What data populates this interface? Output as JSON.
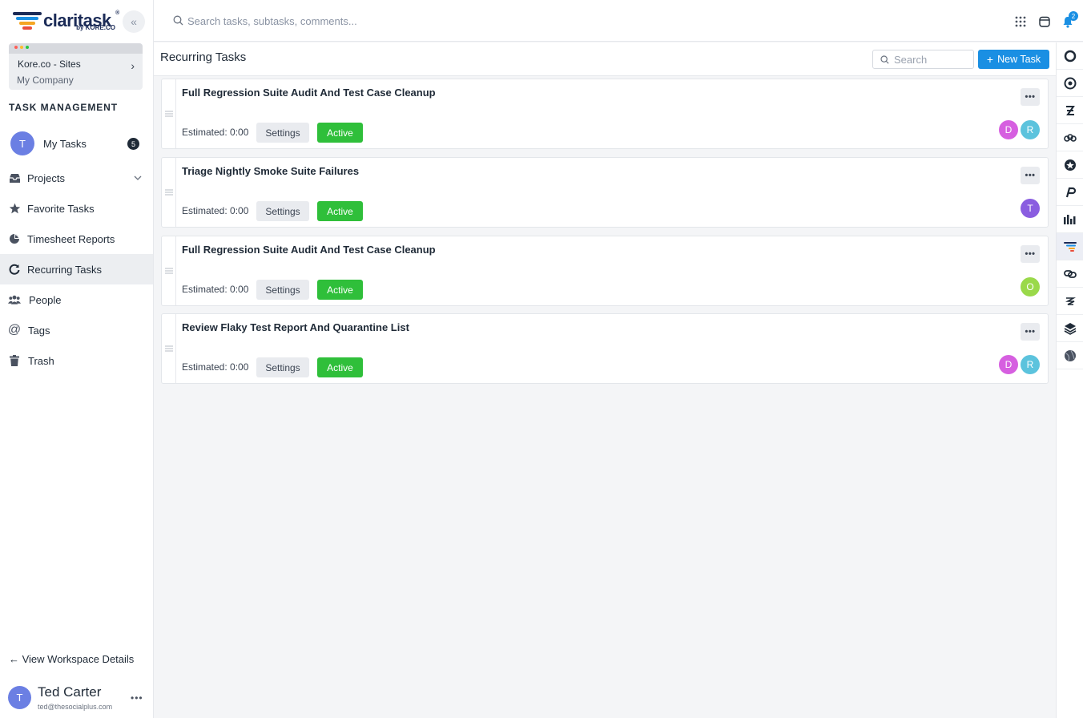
{
  "app": {
    "logo_text": "claritask",
    "logo_sub": "by KORE.CO",
    "logo_reg": "®"
  },
  "workspace": {
    "name": "Kore.co - Sites",
    "company": "My Company"
  },
  "sidebar": {
    "section_title": "TASK MANAGEMENT",
    "my_tasks": {
      "avatar": "T",
      "label": "My Tasks",
      "count": "5"
    },
    "items": [
      {
        "label": "Projects",
        "icon": "inbox-icon"
      },
      {
        "label": "Favorite Tasks",
        "icon": "star-icon"
      },
      {
        "label": "Timesheet Reports",
        "icon": "pie-chart-icon"
      },
      {
        "label": "Recurring Tasks",
        "icon": "refresh-icon"
      },
      {
        "label": "People",
        "icon": "people-icon"
      },
      {
        "label": "Tags",
        "icon": "at-icon"
      },
      {
        "label": "Trash",
        "icon": "trash-icon"
      }
    ],
    "view_workspace": "← View Workspace Details",
    "user": {
      "avatar": "T",
      "name": "Ted Carter",
      "email": "ted@thesocialplus.com",
      "more": "•••"
    }
  },
  "topbar": {
    "search_placeholder": "Search tasks, subtasks, comments...",
    "notification_count": "2"
  },
  "main": {
    "title": "Recurring Tasks",
    "search_placeholder": "Search",
    "new_task_label": "New Task"
  },
  "tasks": [
    {
      "title": "Full Regression Suite Audit And Test Case Cleanup",
      "estimated": "Estimated: 0:00",
      "settings_label": "Settings",
      "status": "Active",
      "assignees": [
        {
          "initial": "D",
          "color": "#d65fe0"
        },
        {
          "initial": "R",
          "color": "#5cc3dd"
        }
      ]
    },
    {
      "title": "Triage Nightly Smoke Suite Failures",
      "estimated": "Estimated: 0:00",
      "settings_label": "Settings",
      "status": "Active",
      "assignees": [
        {
          "initial": "T",
          "color": "#8a5de0"
        }
      ]
    },
    {
      "title": "Full Regression Suite Audit And Test Case Cleanup",
      "estimated": "Estimated: 0:00",
      "settings_label": "Settings",
      "status": "Active",
      "assignees": [
        {
          "initial": "O",
          "color": "#9ad94a"
        }
      ]
    },
    {
      "title": "Review Flaky Test Report And Quarantine List",
      "estimated": "Estimated: 0:00",
      "settings_label": "Settings",
      "status": "Active",
      "assignees": [
        {
          "initial": "D",
          "color": "#d65fe0"
        },
        {
          "initial": "R",
          "color": "#5cc3dd"
        }
      ]
    }
  ],
  "colors": {
    "accent": "#1a8fe3",
    "active_status": "#2fbf3a",
    "brand_navy": "#1b2b57"
  },
  "rail": {
    "apps": [
      "ring-app-icon",
      "target-app-icon",
      "script-app-icon",
      "chain-app-icon",
      "badge-app-icon",
      "p-app-icon",
      "bars-app-icon",
      "claritask-app-icon",
      "link-app-icon",
      "swirl-app-icon",
      "layers-app-icon",
      "globe-app-icon"
    ]
  }
}
